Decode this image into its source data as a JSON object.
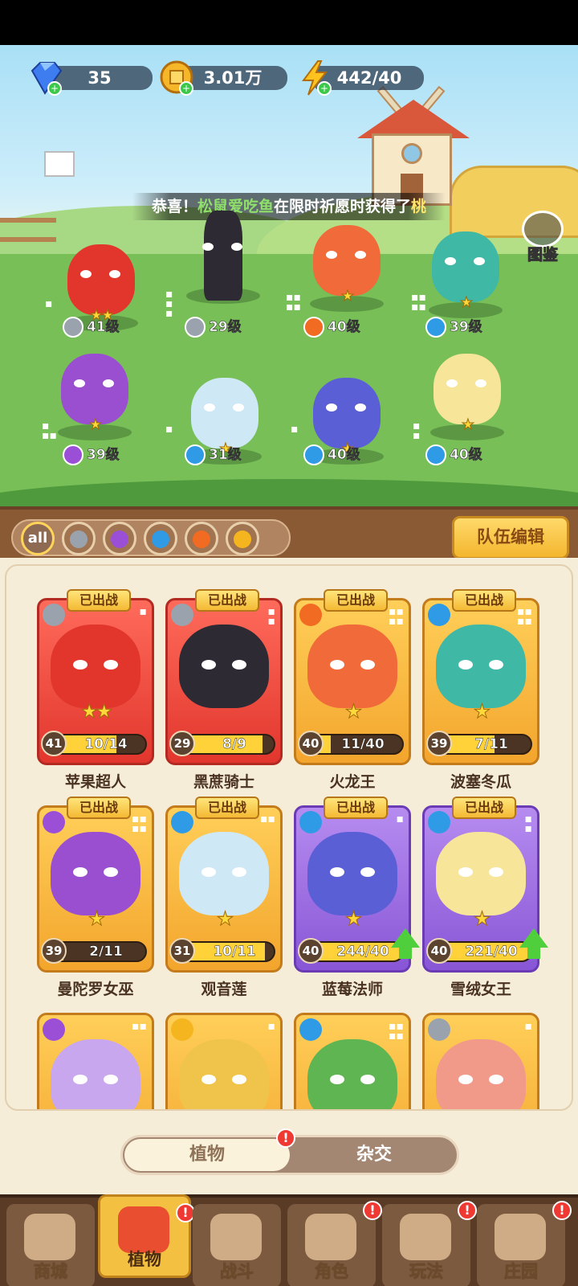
{
  "currency": {
    "gems": "35",
    "coins": "3.01万",
    "energy": "442/40"
  },
  "banner": {
    "prefix": "恭喜！",
    "player": "松鼠爱吃鱼",
    "middle": "在限时祈愿时获得了",
    "item": "桃"
  },
  "codex_label": "图鉴",
  "field_units": [
    {
      "level": "41级",
      "element": "sword",
      "color": "#e2362d",
      "stars": "★★"
    },
    {
      "level": "29级",
      "element": "sword",
      "color": "#2d2a33",
      "stars": ""
    },
    {
      "level": "40级",
      "element": "fire",
      "color": "#f06a3a",
      "stars": "★"
    },
    {
      "level": "39级",
      "element": "water",
      "color": "#3fb8a6",
      "stars": "★"
    },
    {
      "level": "39级",
      "element": "poison",
      "color": "#9a4fd0",
      "stars": "★"
    },
    {
      "level": "31级",
      "element": "water",
      "color": "#cfe8f6",
      "stars": "★"
    },
    {
      "level": "40级",
      "element": "water",
      "color": "#5b5fd6",
      "stars": "★"
    },
    {
      "level": "40级",
      "element": "water",
      "color": "#f7e59a",
      "stars": "★"
    }
  ],
  "filters": {
    "all_label": "all",
    "types": [
      "sword-icon",
      "poison-icon",
      "water-icon",
      "fire-icon",
      "lightning-icon"
    ]
  },
  "team_edit_label": "队伍编辑",
  "deployed_tag": "已出战",
  "cards": [
    {
      "name": "苹果超人",
      "level": "41",
      "progress": "10/14",
      "fill": 0.71,
      "stars": "★★",
      "style": "red",
      "element": "sword",
      "upgrade": false
    },
    {
      "name": "黑蔗骑士",
      "level": "29",
      "progress": "8/9",
      "fill": 0.89,
      "stars": "",
      "style": "red",
      "element": "sword",
      "upgrade": false
    },
    {
      "name": "火龙王",
      "level": "40",
      "progress": "11/40",
      "fill": 0.28,
      "stars": "★",
      "style": "gold",
      "element": "fire",
      "upgrade": false
    },
    {
      "name": "波塞冬瓜",
      "level": "39",
      "progress": "7/11",
      "fill": 0.64,
      "stars": "★",
      "style": "gold",
      "element": "water",
      "upgrade": false
    },
    {
      "name": "曼陀罗女巫",
      "level": "39",
      "progress": "2/11",
      "fill": 0.18,
      "stars": "★",
      "style": "gold",
      "element": "poison",
      "upgrade": false
    },
    {
      "name": "观音莲",
      "level": "31",
      "progress": "10/11",
      "fill": 0.91,
      "stars": "★",
      "style": "gold",
      "element": "water",
      "upgrade": false
    },
    {
      "name": "蓝莓法师",
      "level": "40",
      "progress": "244/40",
      "fill": 1.0,
      "stars": "★",
      "style": "purple",
      "element": "water",
      "upgrade": true
    },
    {
      "name": "雪绒女王",
      "level": "40",
      "progress": "221/40",
      "fill": 1.0,
      "stars": "★",
      "style": "purple",
      "element": "water",
      "upgrade": true
    },
    {
      "name": "",
      "level": "",
      "progress": "",
      "fill": 0,
      "stars": "",
      "style": "gold",
      "element": "poison",
      "upgrade": false
    },
    {
      "name": "",
      "level": "",
      "progress": "",
      "fill": 0,
      "stars": "",
      "style": "gold",
      "element": "lightning",
      "upgrade": false
    },
    {
      "name": "",
      "level": "",
      "progress": "",
      "fill": 0,
      "stars": "",
      "style": "gold",
      "element": "water",
      "upgrade": false
    },
    {
      "name": "",
      "level": "",
      "progress": "",
      "fill": 0,
      "stars": "",
      "style": "gold",
      "element": "sword",
      "upgrade": false
    }
  ],
  "toggle": {
    "plants": "植物",
    "hybrid": "杂交",
    "alert": "!"
  },
  "nav": [
    {
      "label": "商城",
      "alert": false,
      "active": false
    },
    {
      "label": "植物",
      "alert": true,
      "active": true
    },
    {
      "label": "战斗",
      "alert": false,
      "active": false
    },
    {
      "label": "角色",
      "alert": true,
      "active": false
    },
    {
      "label": "玩法",
      "alert": true,
      "active": false
    },
    {
      "label": "庄园",
      "alert": true,
      "active": false
    }
  ],
  "element_colors": {
    "sword": "#9aa3ad",
    "fire": "#f26b22",
    "water": "#2f9be6",
    "poison": "#9b4fd6",
    "lightning": "#f5b51f"
  }
}
